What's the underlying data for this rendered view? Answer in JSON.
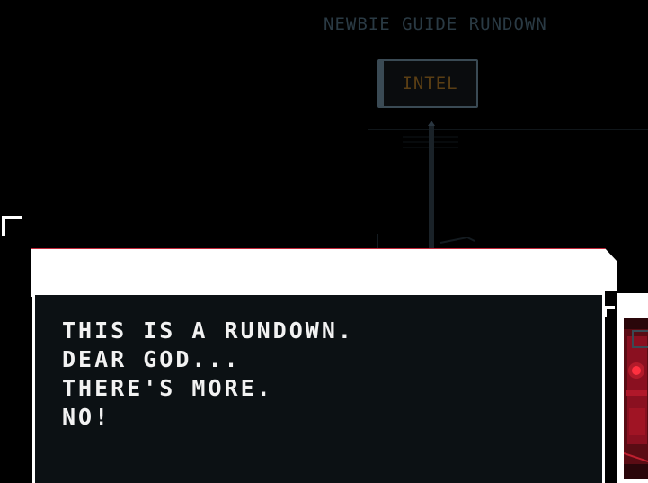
{
  "guide": {
    "title": "NEWBIE GUIDE RUNDOWN",
    "intel_button": "INTEL"
  },
  "dialog": {
    "lines": [
      "THIS IS A RUNDOWN.",
      "DEAR GOD...",
      "THERE'S MORE.",
      "NO!"
    ]
  },
  "colors": {
    "background": "#000000",
    "dim_text": "#2a3a44",
    "intel_text": "#5a3e14",
    "dialog_body": "#0c1114",
    "dialog_header": "#ffffff",
    "accent_red": "#c0283a",
    "portrait_red": "#d0182a"
  },
  "icons": {
    "portrait": "red-glowing-figure-portrait",
    "corner": "corner-bracket"
  }
}
